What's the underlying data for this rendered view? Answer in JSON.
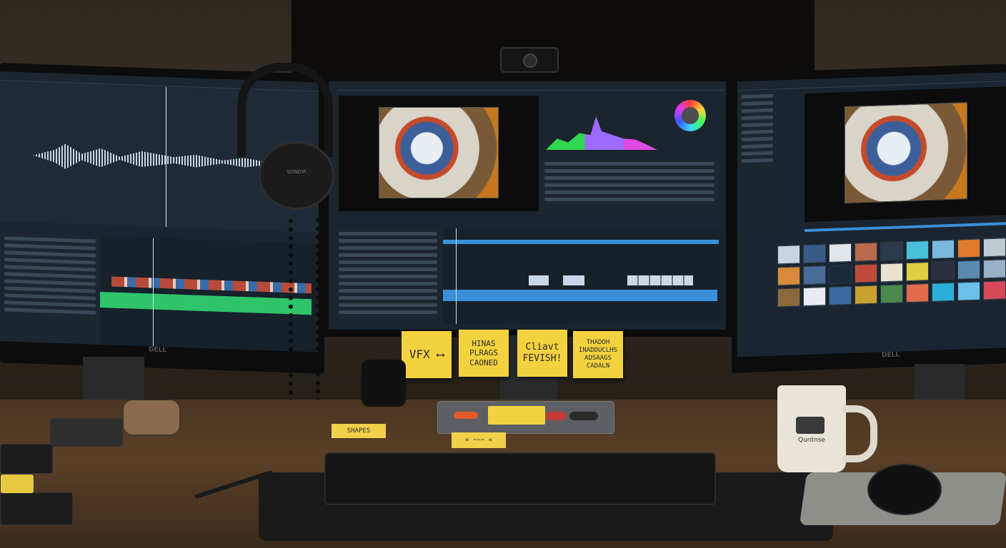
{
  "scene": {
    "description_tags": [
      "video-editing-workstation",
      "three-monitors",
      "desk"
    ],
    "colors": {
      "wall": "#3a322a",
      "desk": "#5a4028",
      "sticky_note": "#f3d23f",
      "ui_accent": "#3a8fd8",
      "ui_green": "#2fd84e",
      "ui_background": "#1a2530"
    }
  },
  "sticky_notes": [
    {
      "text": "VFX ⟷"
    },
    {
      "text": "HINAS PLRAGS CAONED"
    },
    {
      "text": "Cliavt FEVISH!"
    },
    {
      "text": "THADOH INADDUCLHS ADSAAGS CADALN"
    }
  ],
  "desk_notes": [
    {
      "text": "SHAPES"
    },
    {
      "text": "= ~~~ ="
    }
  ],
  "mug": {
    "brand": "Quntnse"
  },
  "headphones": {
    "label": "SONDIR"
  },
  "monitor_brand": {
    "left": "DELL",
    "right": "DELL"
  },
  "icons": [
    "webcam-icon",
    "headphones-icon",
    "keyboard-icon",
    "mouse-icon",
    "mug-icon",
    "color-wheel-icon"
  ]
}
